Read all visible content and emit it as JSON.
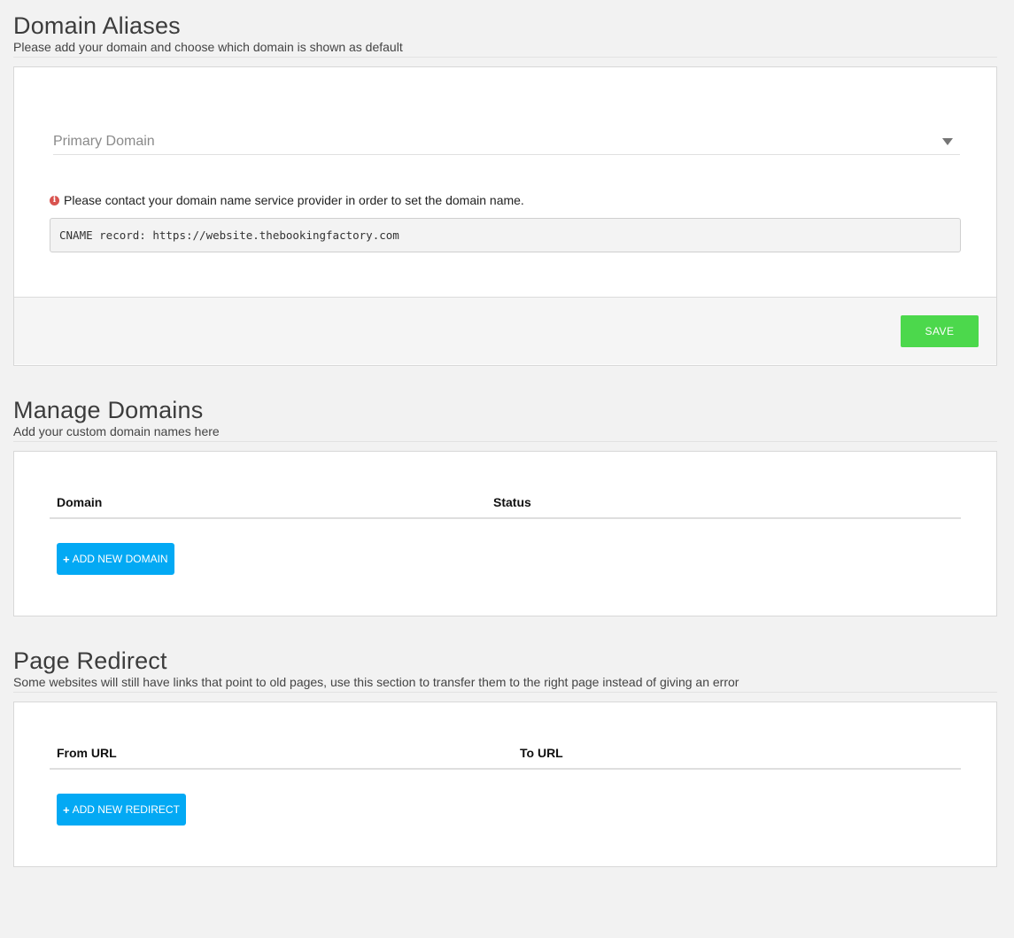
{
  "domain_aliases": {
    "title": "Domain Aliases",
    "subtitle": "Please add your domain and choose which domain is shown as default",
    "primary_domain_placeholder": "Primary Domain",
    "notice": "Please contact your domain name service provider in order to set the domain name.",
    "cname_record": "CNAME record: https://website.thebookingfactory.com",
    "save_label": "SAVE"
  },
  "manage_domains": {
    "title": "Manage Domains",
    "subtitle": "Add your custom domain names here",
    "columns": [
      "Domain",
      "Status"
    ],
    "add_label": "ADD NEW DOMAIN"
  },
  "page_redirect": {
    "title": "Page Redirect",
    "subtitle": "Some websites will still have links that point to old pages, use this section to transfer them to the right page instead of giving an error",
    "columns": [
      "From URL",
      "To URL"
    ],
    "add_label": "ADD NEW REDIRECT"
  },
  "colors": {
    "save_green": "#4cd84c",
    "add_blue": "#03a9f4",
    "info_red": "#d9534f"
  },
  "icons": {
    "info": "info-circle-icon",
    "plus": "plus-icon",
    "caret": "caret-down-icon"
  }
}
